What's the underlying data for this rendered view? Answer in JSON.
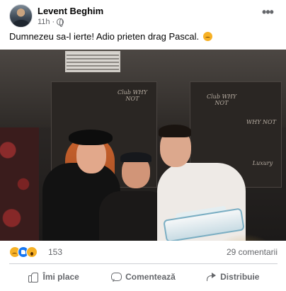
{
  "post": {
    "author": "Levent Beghim",
    "time": "11h",
    "separator": "·",
    "privacy_icon": "globe-icon",
    "menu_icon": "more-dots-icon",
    "menu_glyph": "•••",
    "text": "Dumnezeu sa-l ierte! Adio prieten drag Pascal.",
    "text_emoji": "disappointed-face-emoji"
  },
  "photo": {
    "signage": [
      "Club WHY NOT",
      "Club WHY NOT",
      "WHY NOT",
      "Luxury"
    ]
  },
  "stats": {
    "reaction_icons": [
      "sad-reaction-icon",
      "like-reaction-icon",
      "wow-reaction-icon"
    ],
    "reaction_count": "153",
    "comments": "29 comentarii"
  },
  "actions": {
    "like_label": "Îmi place",
    "comment_label": "Comentează",
    "share_label": "Distribuie"
  }
}
